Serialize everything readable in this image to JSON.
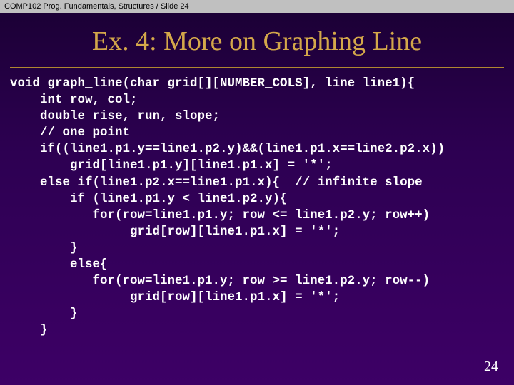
{
  "header": "COMP102 Prog. Fundamentals, Structures / Slide 24",
  "title": "Ex. 4: More on Graphing Line",
  "code": {
    "l01": "void graph_line(char grid[][NUMBER_COLS], line line1){",
    "l02": "    int row, col;",
    "l03": "    double rise, run, slope;",
    "l04": "    // one point",
    "l05": "    if((line1.p1.y==line1.p2.y)&&(line1.p1.x==line2.p2.x))",
    "l06": "        grid[line1.p1.y][line1.p1.x] = '*';",
    "l07": "    else if(line1.p2.x==line1.p1.x){  // infinite slope",
    "l08": "        if (line1.p1.y < line1.p2.y){",
    "l09": "           for(row=line1.p1.y; row <= line1.p2.y; row++)",
    "l10": "                grid[row][line1.p1.x] = '*';",
    "l11": "        }",
    "l12": "        else{",
    "l13": "           for(row=line1.p1.y; row >= line1.p2.y; row--)",
    "l14": "                grid[row][line1.p1.x] = '*';",
    "l15": "        }",
    "l16": "    }"
  },
  "page_number": "24"
}
